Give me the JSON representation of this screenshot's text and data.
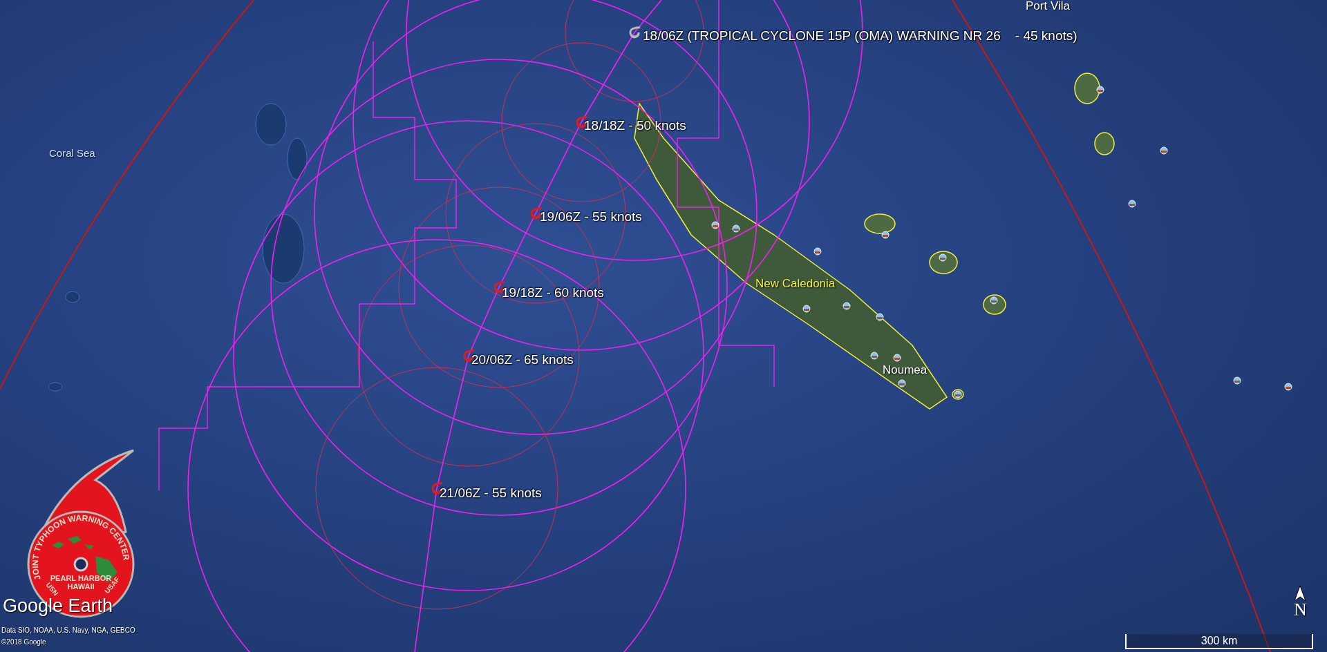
{
  "track_points": [
    {
      "label": "18/06Z (TROPICAL CYCLONE 15P (OMA) WARNING NR 26    - 45 knots)",
      "kind": "current"
    },
    {
      "label": "18/18Z - 50 knots",
      "kind": "forecast"
    },
    {
      "label": "19/06Z - 55 knots",
      "kind": "forecast"
    },
    {
      "label": "19/18Z - 60 knots",
      "kind": "forecast"
    },
    {
      "label": "20/06Z - 65 knots",
      "kind": "forecast"
    },
    {
      "label": "21/06Z - 55 knots",
      "kind": "forecast"
    }
  ],
  "place_labels": [
    {
      "text": "Port Vila",
      "kind": "city"
    },
    {
      "text": "Coral Sea",
      "kind": "sea"
    },
    {
      "text": "New Caledonia",
      "kind": "country"
    },
    {
      "text": "Noumea",
      "kind": "city"
    }
  ],
  "logo": {
    "ring_text": "JOINT TYPHOON WARNING CENTER",
    "lines": [
      "PEARL HARBOR",
      "HAWAII"
    ],
    "left_text": "USN",
    "right_text": "USAF"
  },
  "brand": "Google Earth",
  "attribution": [
    "Data SIO, NOAA, U.S. Navy, NGA, GEBCO",
    "©2018 Google"
  ],
  "scale_bar": {
    "label": "300 km"
  },
  "compass": {
    "label": "N"
  }
}
